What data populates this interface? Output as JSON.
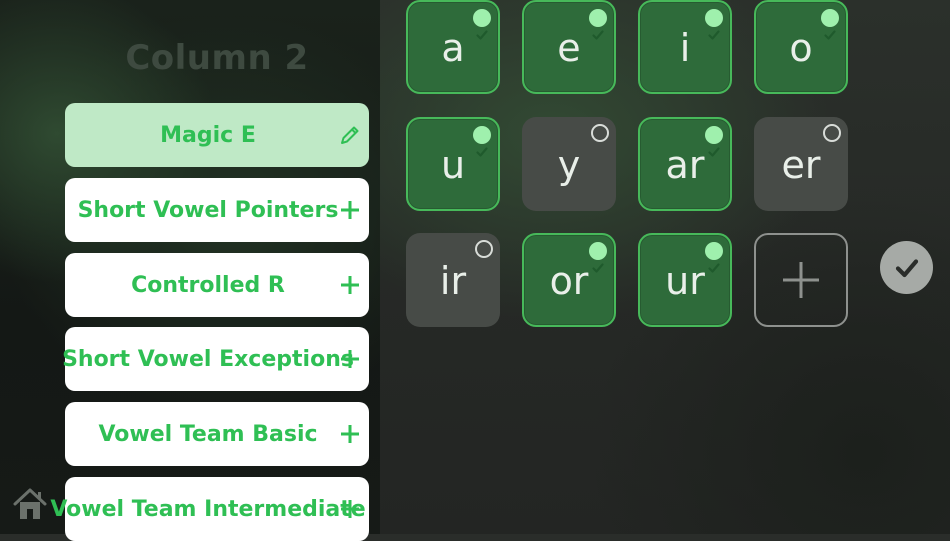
{
  "column_title": "Column 2",
  "categories": [
    {
      "label": "Magic E",
      "action": "edit",
      "selected": true
    },
    {
      "label": "Short Vowel Pointers",
      "action": "add",
      "selected": false
    },
    {
      "label": "Controlled R",
      "action": "add",
      "selected": false
    },
    {
      "label": "Short Vowel Exceptions",
      "action": "add",
      "selected": false
    },
    {
      "label": "Vowel Team Basic",
      "action": "add",
      "selected": false
    },
    {
      "label": "Vowel Team Intermediate",
      "action": "add",
      "selected": false
    }
  ],
  "tiles": [
    {
      "label": "a",
      "checked": true
    },
    {
      "label": "e",
      "checked": true
    },
    {
      "label": "i",
      "checked": true
    },
    {
      "label": "o",
      "checked": true
    },
    {
      "label": "u",
      "checked": true
    },
    {
      "label": "y",
      "checked": false
    },
    {
      "label": "ar",
      "checked": true
    },
    {
      "label": "er",
      "checked": false
    },
    {
      "label": "ir",
      "checked": false
    },
    {
      "label": "or",
      "checked": true
    },
    {
      "label": "ur",
      "checked": true
    }
  ],
  "colors": {
    "accent_green": "#2fbf54",
    "tile_on": "#2e6b3a",
    "tile_off": "#474b47",
    "selected_row": "#bfe9c6"
  },
  "icons": {
    "edit": "pencil-icon",
    "add": "plus-icon",
    "home": "home-icon",
    "confirm": "checkmark-icon"
  }
}
